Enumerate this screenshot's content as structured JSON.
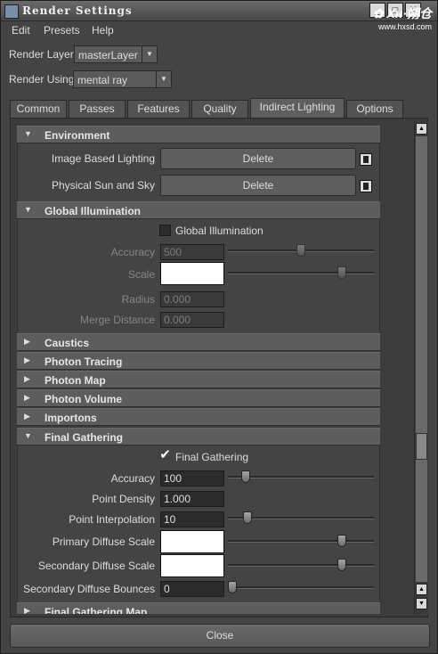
{
  "window": {
    "title": "Render Settings",
    "controls": [
      "_",
      "□",
      "X"
    ],
    "watermark_brand": "✿ Xʜ·朔仓",
    "watermark_url": "www.hxsd.com"
  },
  "menubar": {
    "items": [
      "Edit",
      "Presets",
      "Help"
    ]
  },
  "render_layer": {
    "label": "Render Layer",
    "value": "masterLayer"
  },
  "render_using": {
    "label": "Render Using",
    "value": "mental ray"
  },
  "tabs": [
    {
      "label": "Common",
      "active": false
    },
    {
      "label": "Passes",
      "active": false
    },
    {
      "label": "Features",
      "active": false
    },
    {
      "label": "Quality",
      "active": false
    },
    {
      "label": "Indirect Lighting",
      "active": true
    },
    {
      "label": "Options",
      "active": false
    }
  ],
  "environment": {
    "title": "Environment",
    "expanded": true,
    "rows": [
      {
        "label": "Image Based Lighting",
        "button": "Delete"
      },
      {
        "label": "Physical Sun and Sky",
        "button": "Delete"
      }
    ]
  },
  "global_illumination": {
    "title": "Global Illumination",
    "expanded": true,
    "checkbox_label": "Global Illumination",
    "checked": false,
    "accuracy": {
      "label": "Accuracy",
      "value": "500",
      "slider": 0.5
    },
    "scale": {
      "label": "Scale",
      "color": "#ffffff",
      "slider": 0.8
    },
    "radius": {
      "label": "Radius",
      "value": "0.000"
    },
    "merge_distance": {
      "label": "Merge Distance",
      "value": "0.000"
    }
  },
  "collapsed_sections": [
    "Caustics",
    "Photon Tracing",
    "Photon Map",
    "Photon Volume",
    "Importons"
  ],
  "final_gathering": {
    "title": "Final Gathering",
    "expanded": true,
    "checkbox_label": "Final Gathering",
    "checked": true,
    "checkmark": "✔",
    "accuracy": {
      "label": "Accuracy",
      "value": "100",
      "slider": 0.1
    },
    "point_density": {
      "label": "Point Density",
      "value": "1.000"
    },
    "point_interpolation": {
      "label": "Point Interpolation",
      "value": "10",
      "slider": 0.11
    },
    "primary_diffuse_scale": {
      "label": "Primary Diffuse Scale",
      "color": "#ffffff",
      "slider": 0.8
    },
    "secondary_diffuse_scale": {
      "label": "Secondary Diffuse Scale",
      "color": "#ffffff",
      "slider": 0.8
    },
    "secondary_diffuse_bounces": {
      "label": "Secondary Diffuse Bounces",
      "value": "0",
      "slider": 0.0
    }
  },
  "final_gathering_map": {
    "title": "Final Gathering Map",
    "expanded": false
  },
  "icons": {
    "expanded": "▼",
    "collapsed": "▶",
    "dropdown_arrow": "▼",
    "scroll_up": "▲",
    "scroll_down": "▼"
  },
  "close_button": "Close"
}
